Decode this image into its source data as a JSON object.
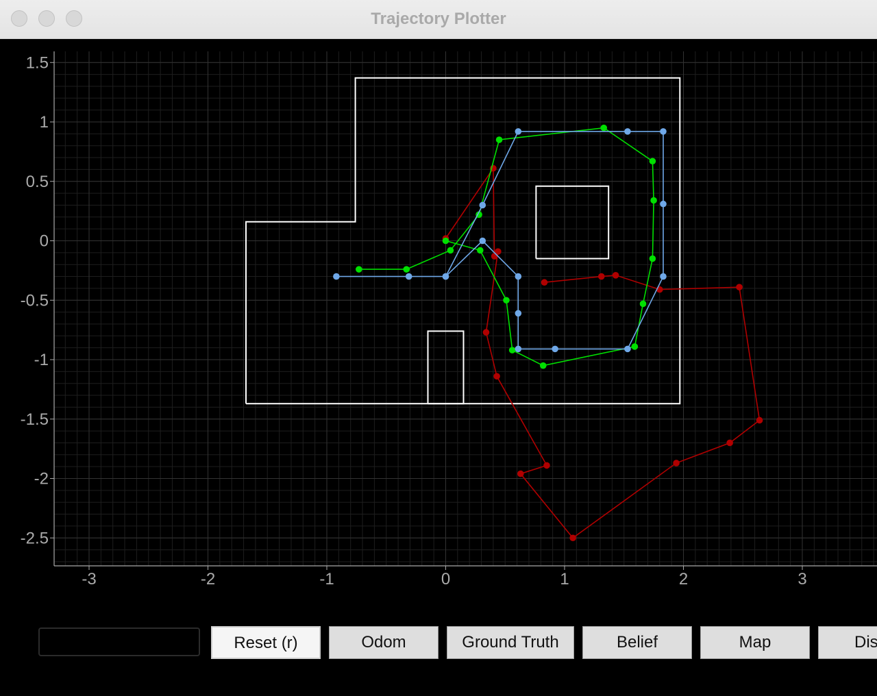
{
  "window": {
    "title": "Trajectory Plotter"
  },
  "toolbar": {
    "command_input": {
      "value": "",
      "placeholder": ""
    },
    "buttons": [
      {
        "label": "Reset (r)",
        "active": true
      },
      {
        "label": "Odom"
      },
      {
        "label": "Ground Truth"
      },
      {
        "label": "Belief"
      },
      {
        "label": "Map"
      },
      {
        "label": "Dis"
      }
    ]
  },
  "colors": {
    "background": "#000000",
    "grid": "#333333",
    "axis": "#aaaaaa",
    "map": "#ffffff",
    "odom": "#b00000",
    "ground_truth": "#00e000",
    "belief": "#6fa8e8"
  },
  "chart_data": {
    "type": "line",
    "xlim": [
      -3.3,
      3.6
    ],
    "ylim": [
      -2.75,
      1.6
    ],
    "xticks": [
      "-3",
      "-2",
      "-1",
      "0",
      "1",
      "2",
      "3"
    ],
    "yticks": [
      "1.5",
      "1",
      "0.5",
      "0",
      "-0.5",
      "-1",
      "-1.5",
      "-2",
      "-2.5"
    ],
    "grid": true,
    "map_outline": [
      [
        -1.68,
        -1.37
      ],
      [
        1.97,
        -1.37
      ],
      [
        1.97,
        1.37
      ],
      [
        -0.76,
        1.37
      ],
      [
        -0.76,
        0.16
      ],
      [
        -1.68,
        0.16
      ],
      [
        -1.68,
        -1.37
      ]
    ],
    "obstacles": [
      [
        [
          0.76,
          -0.15
        ],
        [
          1.37,
          -0.15
        ],
        [
          1.37,
          0.46
        ],
        [
          0.76,
          0.46
        ],
        [
          0.76,
          -0.15
        ]
      ],
      [
        [
          -0.15,
          -1.37
        ],
        [
          0.15,
          -1.37
        ],
        [
          0.15,
          -0.76
        ],
        [
          -0.15,
          -0.76
        ],
        [
          -0.15,
          -1.37
        ]
      ]
    ],
    "series": [
      {
        "color_key": "odom",
        "points": [
          [
            0.0,
            0.02
          ],
          [
            0.4,
            0.61
          ],
          [
            0.41,
            -0.13
          ],
          [
            0.44,
            -0.09
          ],
          [
            0.34,
            -0.77
          ],
          [
            0.43,
            -1.14
          ],
          [
            0.85,
            -1.89
          ],
          [
            0.63,
            -1.96
          ],
          [
            1.07,
            -2.5
          ],
          [
            1.94,
            -1.87
          ],
          [
            2.39,
            -1.7
          ],
          [
            2.64,
            -1.51
          ],
          [
            2.47,
            -0.39
          ],
          [
            1.8,
            -0.41
          ],
          [
            1.43,
            -0.29
          ],
          [
            1.31,
            -0.3
          ],
          [
            0.83,
            -0.35
          ]
        ]
      },
      {
        "color_key": "ground_truth",
        "points": [
          [
            -0.73,
            -0.24
          ],
          [
            -0.33,
            -0.24
          ],
          [
            0.04,
            -0.08
          ],
          [
            0.28,
            0.22
          ],
          [
            0.45,
            0.85
          ],
          [
            1.33,
            0.95
          ],
          [
            1.74,
            0.67
          ],
          [
            1.75,
            0.34
          ],
          [
            1.74,
            -0.15
          ],
          [
            1.66,
            -0.53
          ],
          [
            1.59,
            -0.89
          ],
          [
            0.82,
            -1.05
          ],
          [
            0.56,
            -0.92
          ],
          [
            0.51,
            -0.5
          ],
          [
            0.29,
            -0.08
          ],
          [
            0.0,
            0.0
          ]
        ]
      },
      {
        "color_key": "belief",
        "points": [
          [
            -0.92,
            -0.3
          ],
          [
            -0.31,
            -0.3
          ],
          [
            0.0,
            -0.3
          ],
          [
            0.31,
            0.3
          ],
          [
            0.61,
            0.92
          ],
          [
            1.53,
            0.92
          ],
          [
            1.83,
            0.92
          ],
          [
            1.83,
            0.31
          ],
          [
            1.83,
            -0.3
          ],
          [
            1.53,
            -0.91
          ],
          [
            0.92,
            -0.91
          ],
          [
            0.61,
            -0.91
          ],
          [
            0.61,
            -0.61
          ],
          [
            0.61,
            -0.3
          ],
          [
            0.31,
            0.0
          ],
          [
            0.0,
            -0.3
          ]
        ]
      }
    ]
  }
}
